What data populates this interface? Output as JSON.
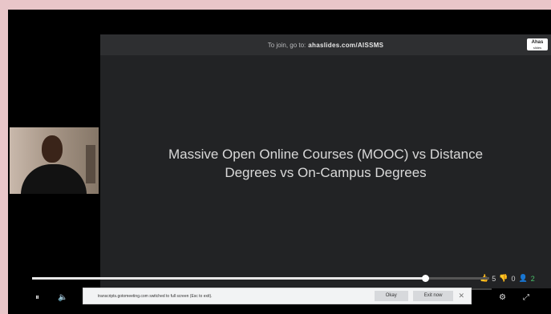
{
  "join_bar": {
    "prefix": "To join, go to:",
    "url": "ahaslides.com/AISSMS"
  },
  "logo": {
    "text": "Ahas",
    "subtext": "slides"
  },
  "slide": {
    "title_line1": "Massive Open Online Courses (MOOC) vs Distance",
    "title_line2": "Degrees vs On-Campus Degrees"
  },
  "reactions": {
    "likes": "5",
    "dislikes": "0",
    "viewers": "2"
  },
  "playback": {
    "progress_fraction": 0.86
  },
  "icons": {
    "pause": "⏸",
    "volume": "🔈",
    "like": "👍",
    "dislike": "👎",
    "viewers": "👤",
    "settings": "⚙",
    "fullscreen": "⤢",
    "close": "✕"
  },
  "notice": {
    "message": "transcripts.gotomeeting.com switched to full screen (Esc to exit).",
    "okay_label": "Okay",
    "exit_label": "Exit now"
  }
}
